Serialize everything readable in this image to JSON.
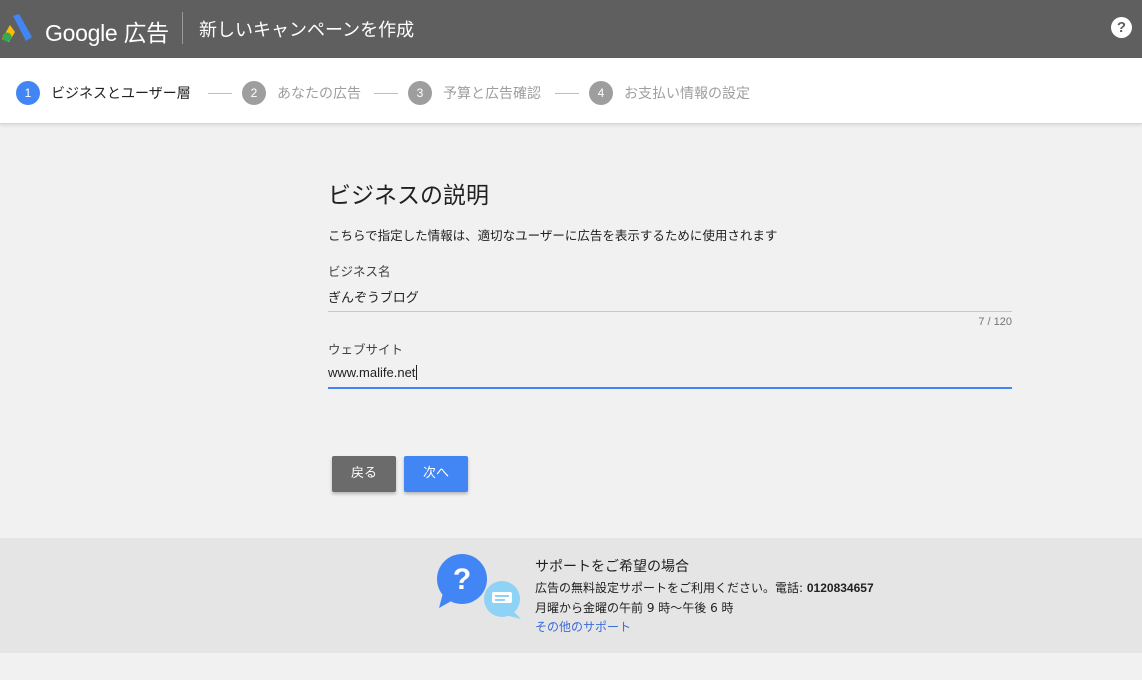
{
  "header": {
    "brand": "Google 広告",
    "title": "新しいキャンペーンを作成",
    "help_icon": "help-circle-icon"
  },
  "stepper": {
    "steps": [
      {
        "number": "1",
        "label": "ビジネスとユーザー層",
        "active": true
      },
      {
        "number": "2",
        "label": "あなたの広告",
        "active": false
      },
      {
        "number": "3",
        "label": "予算と広告確認",
        "active": false
      },
      {
        "number": "4",
        "label": "お支払い情報の設定",
        "active": false
      }
    ]
  },
  "form": {
    "title": "ビジネスの説明",
    "description": "こちらで指定した情報は、適切なユーザーに広告を表示するために使用されます",
    "business_name": {
      "label": "ビジネス名",
      "value": "ぎんぞうブログ",
      "counter": "7 / 120"
    },
    "website": {
      "label": "ウェブサイト",
      "value": "www.malife.net"
    },
    "back_label": "戻る",
    "next_label": "次へ"
  },
  "support": {
    "title": "サポートをご希望の場合",
    "line1_prefix": "広告の無料設定サポートをご利用ください。電話: ",
    "phone": "0120834657",
    "hours": "月曜から金曜の午前 9 時〜午後 6 時",
    "link": "その他のサポート",
    "icon": "support-chat-icon"
  },
  "colors": {
    "accent": "#4285f4",
    "header_bg": "#5f5f5f",
    "page_bg": "#f1f1f1"
  }
}
